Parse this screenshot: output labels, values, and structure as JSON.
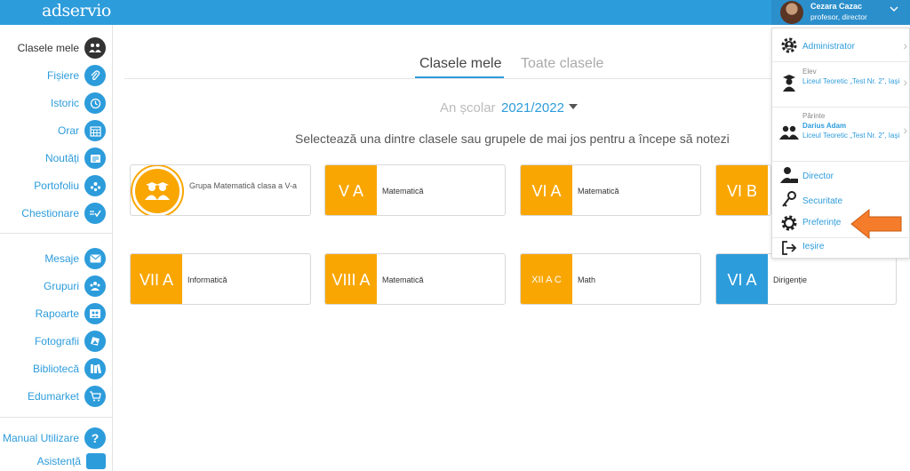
{
  "header": {
    "logo": "adservio",
    "user": {
      "name": "Cezara Cazac",
      "role": "profesor, director"
    }
  },
  "sidebar": {
    "items": [
      {
        "label": "Clasele mele",
        "icon": "classes-icon"
      },
      {
        "label": "Fișiere",
        "icon": "paperclip-icon"
      },
      {
        "label": "Istoric",
        "icon": "history-icon"
      },
      {
        "label": "Orar",
        "icon": "calendar-icon"
      },
      {
        "label": "Noutăți",
        "icon": "news-icon"
      },
      {
        "label": "Portofoliu",
        "icon": "portfolio-icon"
      },
      {
        "label": "Chestionare",
        "icon": "survey-icon"
      },
      {
        "label": "Mesaje",
        "icon": "mail-icon"
      },
      {
        "label": "Grupuri",
        "icon": "groups-icon"
      },
      {
        "label": "Rapoarte",
        "icon": "reports-icon"
      },
      {
        "label": "Fotografii",
        "icon": "photos-icon"
      },
      {
        "label": "Bibliotecă",
        "icon": "library-icon"
      },
      {
        "label": "Edumarket",
        "icon": "cart-icon"
      },
      {
        "label": "Manual Utilizare",
        "icon": "help-icon"
      },
      {
        "label": "Asistență",
        "icon": "chat-icon"
      }
    ]
  },
  "main": {
    "tabs": [
      "Clasele mele",
      "Toate clasele"
    ],
    "year_label": "An școlar",
    "year_value": "2021/2022",
    "instructions": "Selectează una dintre clasele sau grupele de mai jos pentru a începe să notezi",
    "group_card": "Grupa Matematică clasa a V-a",
    "cards": [
      {
        "badge": "V A",
        "subject": "Matematică"
      },
      {
        "badge": "VI A",
        "subject": "Matematică"
      },
      {
        "badge": "VI B",
        "subject": ""
      },
      {
        "badge": "VII A",
        "subject": "Informatică"
      },
      {
        "badge": "VIII A",
        "subject": "Matematică"
      },
      {
        "badge": "XII A C",
        "subject": "Math"
      },
      {
        "badge": "VI A",
        "subject": "Dirigenție"
      }
    ]
  },
  "dropdown": {
    "administrator": "Administrator",
    "elev": {
      "role": "Elev",
      "school": "Liceul Teoretic „Test Nr. 2”, Iași"
    },
    "parinte": {
      "role": "Părinte",
      "name": "Darius Adam",
      "school": "Liceul Teoretic „Test Nr. 2”, Iași"
    },
    "director": "Director",
    "securitate": "Securitate",
    "preferinte": "Preferințe",
    "iesire": "Ieșire"
  },
  "colors": {
    "accent": "#2d9cdb",
    "orange": "#f9a602",
    "arrow": "#f57c2a"
  }
}
